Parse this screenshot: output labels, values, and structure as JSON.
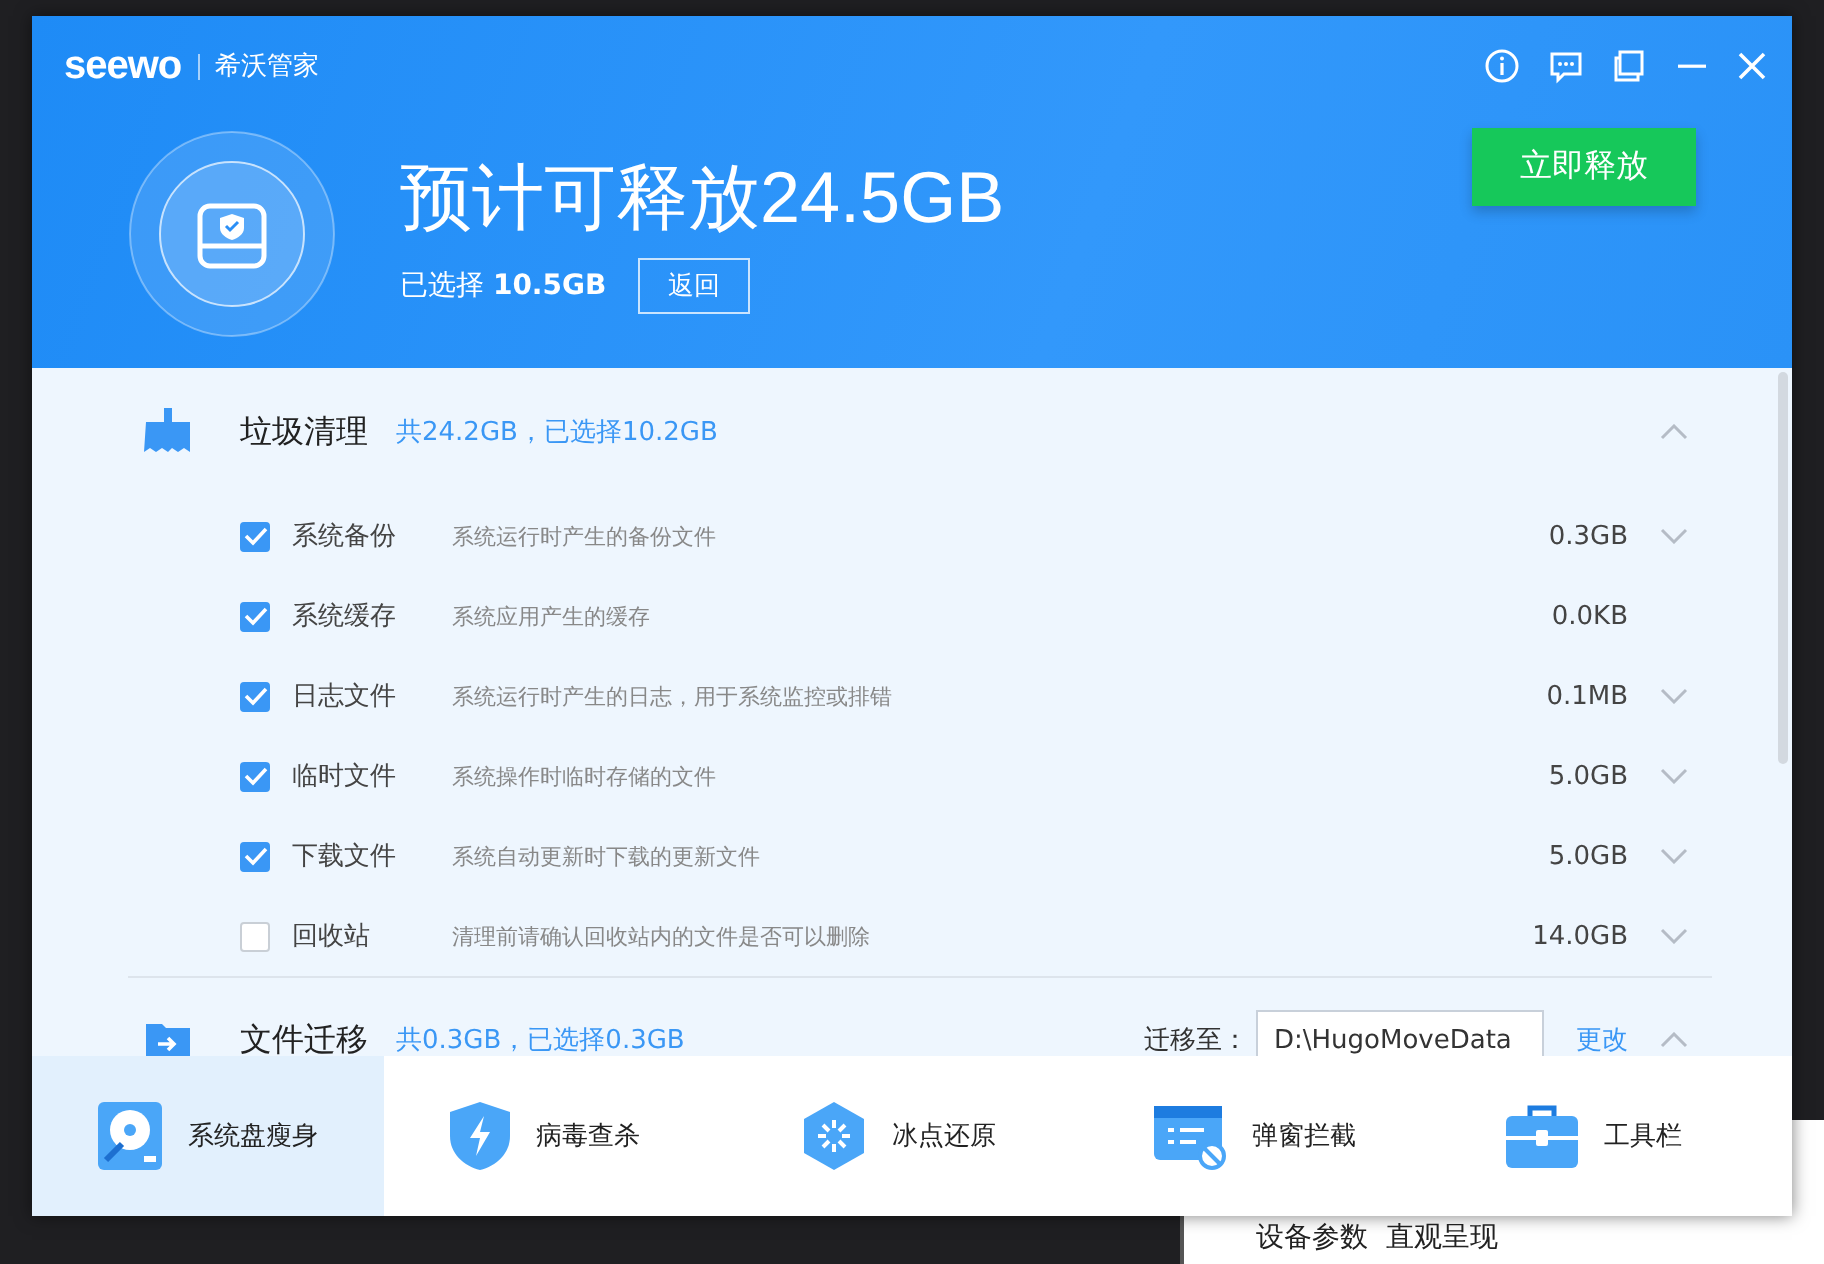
{
  "background_window": {
    "text": "设备参数  直观呈现"
  },
  "window": {
    "logo": "seewo",
    "title": "希沃管家"
  },
  "header": {
    "headline": "预计可释放24.5GB",
    "selected_label": "已选择 **10.5GB**",
    "back_button": "返回",
    "release_button": "立即释放"
  },
  "sections": [
    {
      "kind": "junk",
      "title": "垃圾清理",
      "summary": "共24.2GB，已选择10.2GB",
      "expanded": true,
      "items": [
        {
          "name": "系统备份",
          "description": "系统运行时产生的备份文件",
          "size": "0.3GB",
          "checked": true,
          "expandable": true
        },
        {
          "name": "系统缓存",
          "description": "系统应用产生的缓存",
          "size": "0.0KB",
          "checked": true,
          "expandable": false
        },
        {
          "name": "日志文件",
          "description": "系统运行时产生的日志，用于系统监控或排错",
          "size": "0.1MB",
          "checked": true,
          "expandable": true
        },
        {
          "name": "临时文件",
          "description": "系统操作时临时存储的文件",
          "size": "5.0GB",
          "checked": true,
          "expandable": true
        },
        {
          "name": "下载文件",
          "description": "系统自动更新时下载的更新文件",
          "size": "5.0GB",
          "checked": true,
          "expandable": true
        },
        {
          "name": "回收站",
          "description": "清理前请确认回收站内的文件是否可以删除",
          "size": "14.0GB",
          "checked": false,
          "expandable": true
        }
      ]
    },
    {
      "kind": "migrate",
      "title": "文件迁移",
      "summary": "共0.3GB，已选择0.3GB",
      "expanded": true,
      "target_label": "迁移至：",
      "target_path": "D:\\HugoMoveData",
      "change_link": "更改"
    }
  ],
  "nav": [
    {
      "kind": "disk",
      "label": "系统盘瘦身",
      "selected": true
    },
    {
      "kind": "shield",
      "label": "病毒查杀",
      "selected": false
    },
    {
      "kind": "freeze",
      "label": "冰点还原",
      "selected": false
    },
    {
      "kind": "popup",
      "label": "弹窗拦截",
      "selected": false
    },
    {
      "kind": "toolbox",
      "label": "工具栏",
      "selected": false
    }
  ]
}
